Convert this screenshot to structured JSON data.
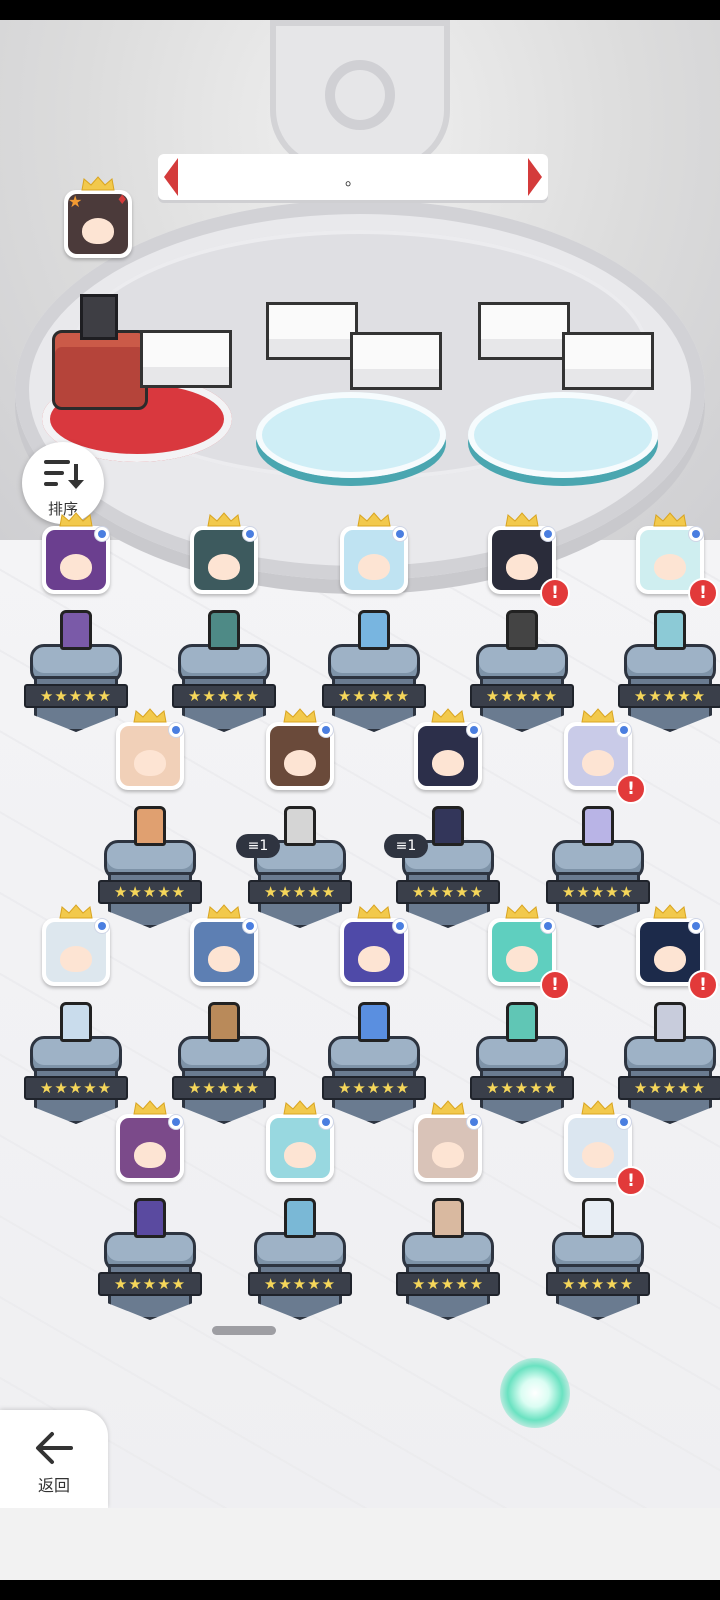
{
  "banner": {
    "text": "。"
  },
  "sort_button": {
    "label": "排序",
    "icon": "sort-descending-icon"
  },
  "back_button": {
    "label": "返回",
    "icon": "arrow-left-icon"
  },
  "leader_portrait": {
    "badges": [
      "star",
      "suit-diamond"
    ]
  },
  "roster": {
    "star_rating": "★★★★★",
    "rows": [
      [
        {
          "face": "#6b3f8f",
          "hero": "#7a5aa8",
          "alert": false
        },
        {
          "face": "#3d5a5e",
          "hero": "#4e8a86",
          "alert": false
        },
        {
          "face": "#bfe3f2",
          "hero": "#78b5e0",
          "alert": false
        },
        {
          "face": "#2a2c3a",
          "hero": "#444",
          "alert": true
        },
        {
          "face": "#cfeef0",
          "hero": "#8ccad6",
          "alert": true
        }
      ],
      [
        {
          "face": "#f1d0b8",
          "hero": "#e0a070",
          "alert": false
        },
        {
          "face": "#6a4a3a",
          "hero": "#d5d5d5",
          "alert": false
        },
        {
          "face": "#2c2f4a",
          "hero": "#33365a",
          "alert": false
        },
        {
          "face": "#c9cbe8",
          "hero": "#b9b4e6",
          "alert": true
        }
      ],
      [
        {
          "face": "#dde7ee",
          "hero": "#c9dcec",
          "alert": false
        },
        {
          "face": "#5d7fb3",
          "hero": "#b98a5a",
          "alert": false
        },
        {
          "face": "#4f4aa8",
          "hero": "#5a8fe0",
          "alert": false
        },
        {
          "face": "#5fcfbf",
          "hero": "#60c6b5",
          "alert": true
        },
        {
          "face": "#1c2a4a",
          "hero": "#c8ccdc",
          "alert": true
        }
      ],
      [
        {
          "face": "#7b4a8a",
          "hero": "#5a4aa0",
          "alert": false
        },
        {
          "face": "#98d8e0",
          "hero": "#7ab8d6",
          "alert": false
        },
        {
          "face": "#d9c3b8",
          "hero": "#d9b9a0",
          "alert": false
        },
        {
          "face": "#dbe6f0",
          "hero": "#e8eef5",
          "alert": true
        }
      ]
    ],
    "layer_tag": "1"
  }
}
